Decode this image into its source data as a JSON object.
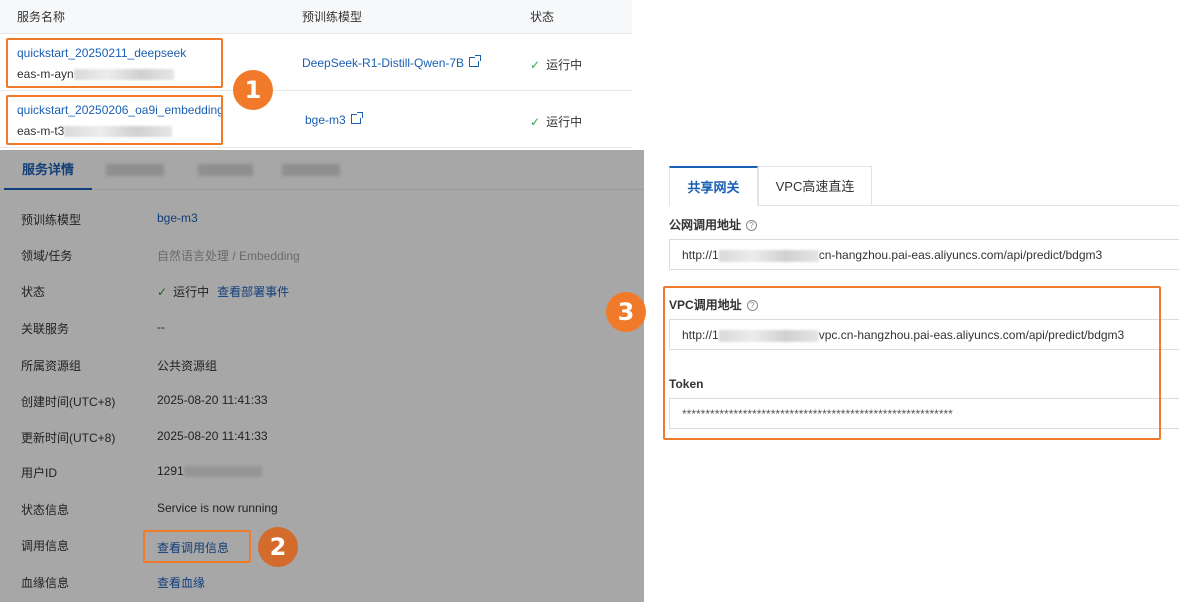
{
  "table": {
    "headers": {
      "name": "服务名称",
      "model": "预训练模型",
      "status": "状态"
    },
    "rows": [
      {
        "name": "quickstart_20250211_deepseek",
        "id_prefix": "eas-m-ayn",
        "model": "DeepSeek-R1-Distill-Qwen-7B",
        "status": "运行中"
      },
      {
        "name": "quickstart_20250206_oa9i_embedding",
        "id_prefix": "eas-m-t3",
        "model": "bge-m3",
        "status": "运行中"
      }
    ]
  },
  "badges": {
    "one": "1",
    "two": "2",
    "three": "3"
  },
  "detail": {
    "active_tab": "服务详情",
    "fields": {
      "model_label": "预训练模型",
      "model_value": "bge-m3",
      "domain_label": "领域/任务",
      "domain_value": "自然语言处理 / Embedding",
      "status_label": "状态",
      "status_value": "运行中",
      "status_link": "查看部署事件",
      "related_label": "关联服务",
      "related_value": "--",
      "group_label": "所属资源组",
      "group_value": "公共资源组",
      "created_label": "创建时间(UTC+8)",
      "created_value": "2025-08-20 11:41:33",
      "updated_label": "更新时间(UTC+8)",
      "updated_value": "2025-08-20 11:41:33",
      "user_label": "用户ID",
      "user_value": "1291",
      "info_label": "状态信息",
      "info_value": "Service is now running",
      "invoke_label": "调用信息",
      "invoke_link": "查看调用信息",
      "lineage_label": "血缘信息",
      "lineage_link": "查看血缘"
    }
  },
  "invoke": {
    "tabs": [
      "共享网关",
      "VPC高速直连"
    ],
    "public_label": "公网调用地址",
    "public_prefix": "http://1",
    "public_suffix": "cn-hangzhou.pai-eas.aliyuncs.com/api/predict/bdgm3",
    "vpc_label": "VPC调用地址",
    "vpc_prefix": "http://1",
    "vpc_suffix": "vpc.cn-hangzhou.pai-eas.aliyuncs.com/api/predict/bdgm3",
    "token_label": "Token",
    "token_value": "**********************************************************"
  },
  "colors": {
    "accent": "#1a5fb4",
    "highlight": "#f07a2a",
    "success": "#2fa84f"
  }
}
